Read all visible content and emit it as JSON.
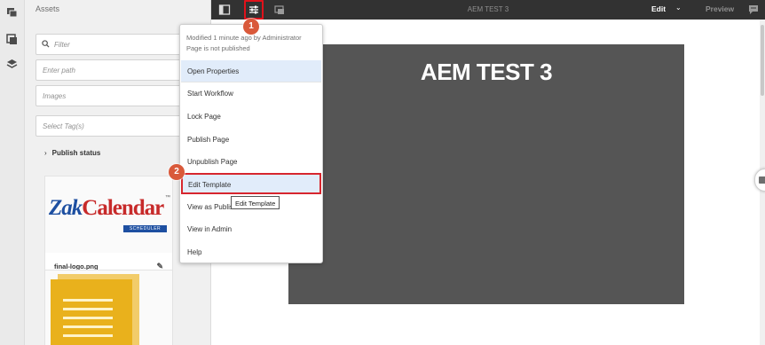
{
  "assets_panel": {
    "title": "Assets",
    "filter_placeholder": "Filter",
    "path_placeholder": "Enter path",
    "type_value": "Images",
    "tags_placeholder": "Select Tag(s)",
    "publish_status_label": "Publish status",
    "cards": [
      {
        "name": "final-logo.png",
        "logo_text_a": "Zak",
        "logo_text_b": "Calendar",
        "logo_sub": "SCHEDULER",
        "logo_tm": "™"
      }
    ]
  },
  "topbar": {
    "page_title": "AEM TEST 3",
    "mode_label": "Edit",
    "preview_label": "Preview"
  },
  "page": {
    "hero_title": "AEM TEST 3"
  },
  "page_menu": {
    "info_line1": "Modified 1 minute ago by Administrator",
    "info_line2": "Page is not published",
    "items": [
      {
        "label": "Open Properties"
      },
      {
        "label": "Start Workflow"
      },
      {
        "label": "Lock Page"
      },
      {
        "label": "Publish Page"
      },
      {
        "label": "Unpublish Page"
      },
      {
        "label": "Edit Template"
      },
      {
        "label": "View as Published"
      },
      {
        "label": "View in Admin"
      },
      {
        "label": "Help"
      }
    ]
  },
  "tooltip": "Edit Template",
  "annotations": {
    "step1": "1",
    "step2": "2"
  },
  "colors": {
    "highlight_red": "#d7262e",
    "badge": "#d9593a",
    "topbar": "#323232",
    "hero": "#555555",
    "menu_hover": "#e1ecfa"
  }
}
